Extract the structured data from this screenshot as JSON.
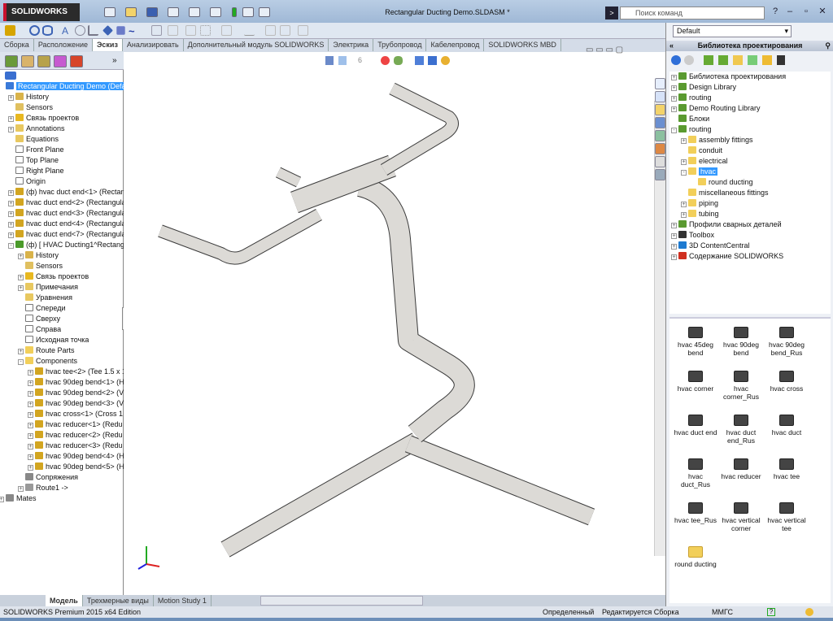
{
  "app": {
    "logo": "SOLIDWORKS",
    "title": "Rectangular Ducting Demo.SLDASM *",
    "search_placeholder": "Поиск команд"
  },
  "tabs": [
    "Сборка",
    "Расположение",
    "Эскиз",
    "Анализировать",
    "Дополнительный модуль SOLIDWORKS",
    "Электрика",
    "Трубопровод",
    "Кабелепровод",
    "SOLIDWORKS MBD"
  ],
  "active_tab": "Эскиз",
  "feature_tree": [
    {
      "label": "Rectangular Ducting Demo  (Default",
      "level": 0,
      "icon": "assembly-icon",
      "selected": true
    },
    {
      "label": "History",
      "level": 1,
      "icon": "history-icon",
      "exp": "+"
    },
    {
      "label": "Sensors",
      "level": 1,
      "icon": "sensors-icon"
    },
    {
      "label": "Связь проектов",
      "level": 1,
      "icon": "design-binder-icon",
      "exp": "+"
    },
    {
      "label": "Annotations",
      "level": 1,
      "icon": "annotations-icon",
      "exp": "+"
    },
    {
      "label": "Equations",
      "level": 1,
      "icon": "equations-icon"
    },
    {
      "label": "Front Plane",
      "level": 1,
      "icon": "plane-icon"
    },
    {
      "label": "Top Plane",
      "level": 1,
      "icon": "plane-icon"
    },
    {
      "label": "Right Plane",
      "level": 1,
      "icon": "plane-icon"
    },
    {
      "label": "Origin",
      "level": 1,
      "icon": "origin-icon"
    },
    {
      "label": "(ф) hvac duct end<1> (Rectangular",
      "level": 1,
      "icon": "part-icon",
      "exp": "+"
    },
    {
      "label": "hvac duct end<2> (Rectangular",
      "level": 1,
      "icon": "part-icon",
      "exp": "+"
    },
    {
      "label": "hvac duct end<3> (Rectangular",
      "level": 1,
      "icon": "part-icon",
      "exp": "+"
    },
    {
      "label": "hvac duct end<4> (Rectangular",
      "level": 1,
      "icon": "part-icon",
      "exp": "+"
    },
    {
      "label": "hvac duct end<7> (Rectangular",
      "level": 1,
      "icon": "part-icon",
      "exp": "+"
    },
    {
      "label": "(ф) [ HVAC Ducting1^Rectangular",
      "level": 1,
      "icon": "subassembly-icon",
      "exp": "-"
    },
    {
      "label": "History",
      "level": 2,
      "icon": "history-icon",
      "exp": "+"
    },
    {
      "label": "Sensors",
      "level": 2,
      "icon": "sensors-icon"
    },
    {
      "label": "Связь проектов",
      "level": 2,
      "icon": "design-binder-icon",
      "exp": "+"
    },
    {
      "label": "Примечания",
      "level": 2,
      "icon": "annotations-icon",
      "exp": "+"
    },
    {
      "label": "Уравнения",
      "level": 2,
      "icon": "equations-icon"
    },
    {
      "label": "Спереди",
      "level": 2,
      "icon": "plane-icon"
    },
    {
      "label": "Сверху",
      "level": 2,
      "icon": "plane-icon"
    },
    {
      "label": "Справа",
      "level": 2,
      "icon": "plane-icon"
    },
    {
      "label": "Исходная точка",
      "level": 2,
      "icon": "origin-icon"
    },
    {
      "label": "Route Parts",
      "level": 2,
      "icon": "folder-icon",
      "exp": "+"
    },
    {
      "label": "Components",
      "level": 2,
      "icon": "folder-icon",
      "exp": "-"
    },
    {
      "label": "hvac tee<2> (Tee 1.5 x 1",
      "level": 3,
      "icon": "part-icon",
      "exp": "+"
    },
    {
      "label": "hvac 90deg bend<1> (H",
      "level": 3,
      "icon": "part-icon",
      "exp": "+"
    },
    {
      "label": "hvac 90deg bend<2> (V",
      "level": 3,
      "icon": "part-icon",
      "exp": "+"
    },
    {
      "label": "hvac 90deg bend<3> (V",
      "level": 3,
      "icon": "part-icon",
      "exp": "+"
    },
    {
      "label": "hvac cross<1> (Cross 1",
      "level": 3,
      "icon": "part-icon",
      "exp": "+"
    },
    {
      "label": "hvac reducer<1> (Redu",
      "level": 3,
      "icon": "part-icon",
      "exp": "+"
    },
    {
      "label": "hvac reducer<2> (Redu",
      "level": 3,
      "icon": "part-icon",
      "exp": "+"
    },
    {
      "label": "hvac reducer<3> (Redu",
      "level": 3,
      "icon": "part-icon",
      "exp": "+"
    },
    {
      "label": "hvac 90deg bend<4> (H",
      "level": 3,
      "icon": "part-icon",
      "exp": "+"
    },
    {
      "label": "hvac 90deg bend<5> (H",
      "level": 3,
      "icon": "part-icon",
      "exp": "+"
    },
    {
      "label": "Сопряжения",
      "level": 2,
      "icon": "mates-icon"
    },
    {
      "label": "Route1 ->",
      "level": 2,
      "icon": "route-icon",
      "exp": "+"
    },
    {
      "label": "Mates",
      "level": 0,
      "icon": "mates-icon",
      "exp": "+"
    }
  ],
  "right_panel": {
    "configuration": "Default",
    "header": "Библиотека проектирования",
    "tree": [
      {
        "label": "Библиотека проектирования",
        "level": 0,
        "icon": "library-icon",
        "exp": "+"
      },
      {
        "label": "Design Library",
        "level": 0,
        "icon": "library-icon",
        "exp": "+"
      },
      {
        "label": "routing",
        "level": 0,
        "icon": "library-icon",
        "exp": "+"
      },
      {
        "label": "Demo Routing Library",
        "level": 0,
        "icon": "library-icon",
        "exp": "+"
      },
      {
        "label": "Блоки",
        "level": 0,
        "icon": "library-icon"
      },
      {
        "label": "routing",
        "level": 0,
        "icon": "library-icon",
        "exp": "-"
      },
      {
        "label": "assembly fittings",
        "level": 1,
        "icon": "folder-icon",
        "exp": "+"
      },
      {
        "label": "conduit",
        "level": 1,
        "icon": "folder-icon"
      },
      {
        "label": "electrical",
        "level": 1,
        "icon": "folder-icon",
        "exp": "+"
      },
      {
        "label": "hvac",
        "level": 1,
        "icon": "folder-icon",
        "exp": "-",
        "selected": true
      },
      {
        "label": "round ducting",
        "level": 2,
        "icon": "folder-icon"
      },
      {
        "label": "miscellaneous fittings",
        "level": 1,
        "icon": "folder-icon"
      },
      {
        "label": "piping",
        "level": 1,
        "icon": "folder-icon",
        "exp": "+"
      },
      {
        "label": "tubing",
        "level": 1,
        "icon": "folder-icon",
        "exp": "+"
      },
      {
        "label": "Профили сварных деталей",
        "level": 0,
        "icon": "library-icon",
        "exp": "+"
      },
      {
        "label": "Toolbox",
        "level": 0,
        "icon": "toolbox-icon",
        "exp": "+"
      },
      {
        "label": "3D ContentCentral",
        "level": 0,
        "icon": "globe-icon",
        "exp": "+"
      },
      {
        "label": "Содержание SOLIDWORKS",
        "level": 0,
        "icon": "solidworks-content-icon",
        "exp": "+"
      }
    ],
    "gallery": [
      "hvac 45deg bend",
      "hvac 90deg bend",
      "hvac 90deg bend_Rus",
      "hvac corner",
      "hvac corner_Rus",
      "hvac cross",
      "hvac duct end",
      "hvac duct end_Rus",
      "hvac duct",
      "hvac duct_Rus",
      "hvac reducer",
      "hvac tee",
      "hvac tee_Rus",
      "hvac vertical corner",
      "hvac vertical tee",
      "round ducting"
    ]
  },
  "bottom_tabs": [
    "Модель",
    "Трехмерные виды",
    "Motion Study 1"
  ],
  "status": {
    "edition": "SOLIDWORKS Premium 2015 x64 Edition",
    "state": "Определенный",
    "editing": "Редактируется Сборка",
    "units": "ММГС"
  },
  "colors": {
    "duct_fill": "#dcdad6",
    "duct_edge": "#3a3a3a",
    "selection": "#3399ff",
    "title_bar": "#a9c1dd"
  }
}
